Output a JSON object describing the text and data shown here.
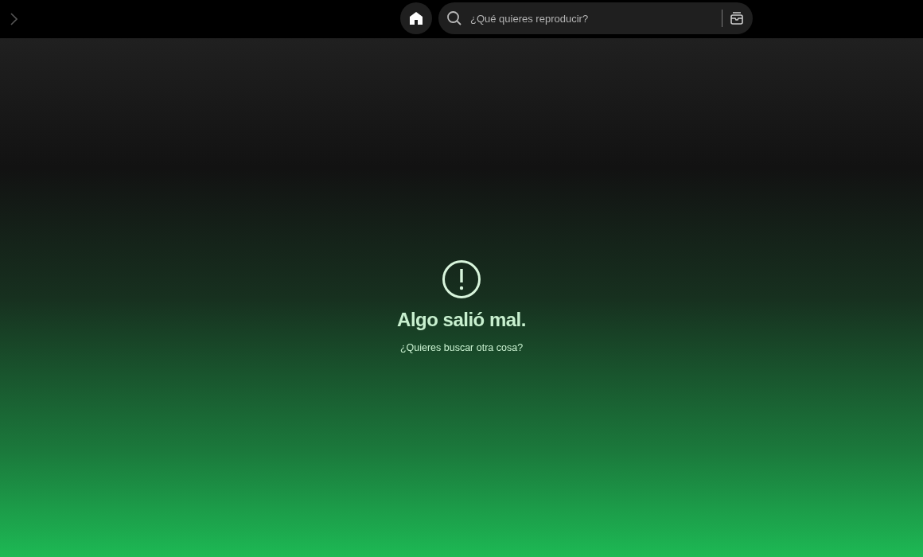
{
  "top_bar": {
    "search": {
      "placeholder": "¿Qué quieres reproducir?"
    }
  },
  "error": {
    "title": "Algo salió mal.",
    "link": "¿Quieres buscar otra cosa?"
  }
}
